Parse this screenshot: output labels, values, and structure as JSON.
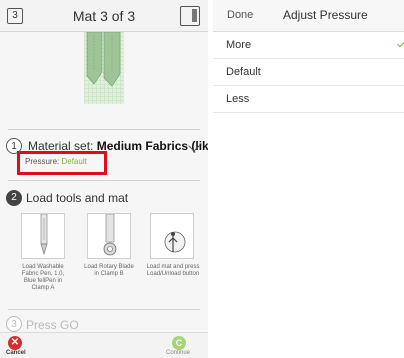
{
  "left": {
    "mat_number": "3",
    "mat_title": "Mat 3 of 3",
    "step1": {
      "number": "1",
      "label": "Material set:",
      "material": "Medium Fabrics (lik...",
      "pressure_label": "Pressure:",
      "pressure_value": "Default"
    },
    "step2": {
      "number": "2",
      "label": "Load tools and mat",
      "tools": [
        {
          "caption": "Load Washable Fabric Pen, 1.0, Blue fellPen in Clamp A",
          "icon": "pen-icon"
        },
        {
          "caption": "Load Rotary Blade in Clamp B",
          "icon": "rotary-blade-icon"
        },
        {
          "caption": "Load mat and press Load/Unload button",
          "icon": "press-button-icon"
        }
      ]
    },
    "step3": {
      "number": "3",
      "label": "Press GO"
    },
    "bottom": {
      "cancel_label": "Cancel",
      "continue_label": "Continue"
    }
  },
  "right": {
    "done_label": "Done",
    "title": "Adjust Pressure",
    "options": [
      {
        "label": "More",
        "selected": true
      },
      {
        "label": "Default",
        "selected": false
      },
      {
        "label": "Less",
        "selected": false
      }
    ]
  },
  "colors": {
    "accent_green": "#7cb342",
    "highlight_red": "#e10b1f",
    "cancel_red": "#d32f2f",
    "continue_green": "#a7d477"
  }
}
